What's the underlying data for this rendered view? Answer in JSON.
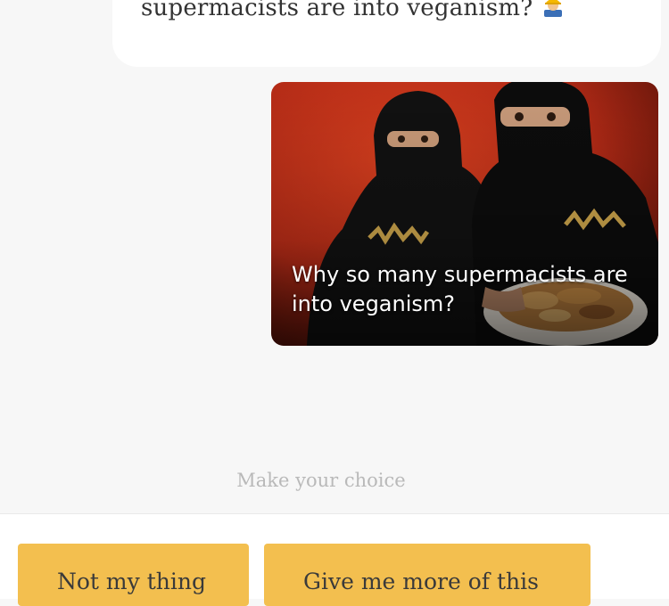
{
  "chat": {
    "message_text": "supermacists are into veganism?",
    "message_emoji": "worker-emoji-icon",
    "media_caption": "Why so many supermacists are into veganism?"
  },
  "prompt": {
    "text": "Make your choice"
  },
  "choices": [
    {
      "label": "Not my thing"
    },
    {
      "label": "Give me more of this"
    }
  ],
  "colors": {
    "background": "#f7f7f7",
    "bubble": "#ffffff",
    "button": "#f3bf4f",
    "prompt_text": "#b9b9b9",
    "media_background": "#c2301a"
  }
}
